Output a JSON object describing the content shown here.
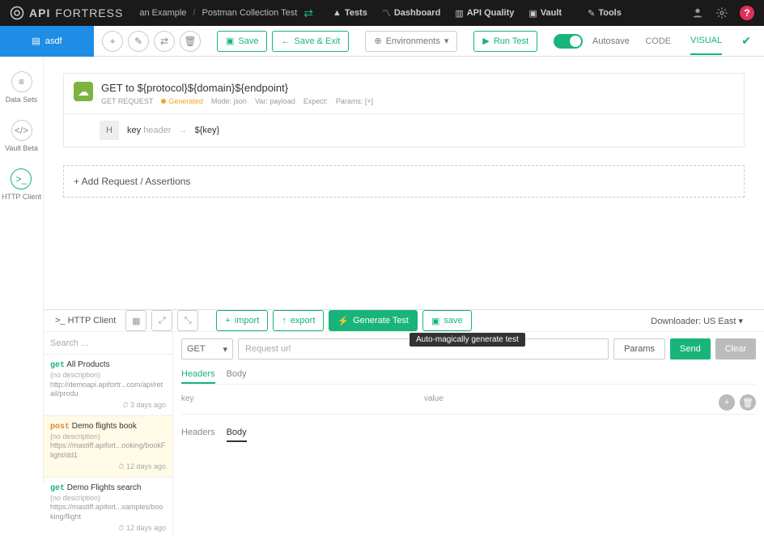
{
  "brand": {
    "bold": "API",
    "thin": "FORTRESS"
  },
  "breadcrumb": {
    "a": "an Example",
    "b": "Postman Collection Test"
  },
  "topnav": {
    "tests": "Tests",
    "dashboard": "Dashboard",
    "quality": "API Quality",
    "vault": "Vault",
    "tools": "Tools"
  },
  "file_tab": "asdf",
  "toolbar": {
    "save": "Save",
    "save_exit": "Save & Exit",
    "environments": "Environments",
    "run_test": "Run Test",
    "autosave": "Autosave",
    "code": "CODE",
    "visual": "VISUAL"
  },
  "rail": {
    "datasets": "Data Sets",
    "vault": "Vault Beta",
    "http": "HTTP Client"
  },
  "request": {
    "title": "GET to ${protocol}${domain}${endpoint}",
    "sub": "GET REQUEST",
    "gen": "Generated",
    "mode_l": "Mode:",
    "mode_v": "json",
    "var_l": "Var:",
    "var_v": "payload",
    "expect_l": "Expect:",
    "params_l": "Params:",
    "params_v": "[+]",
    "hk": "key",
    "hk2": "header",
    "hv": "${key}"
  },
  "add_req": "+ Add Request / Assertions",
  "bottom_bar": {
    "title": "HTTP Client",
    "import": "import",
    "export": "export",
    "generate": "Generate Test",
    "save": "save",
    "downloader": "Downloader: US East",
    "tooltip": "Auto-magically generate test"
  },
  "search_placeholder": "Search ...",
  "history": [
    {
      "verb": "get",
      "name": "All Products",
      "desc": "(no description)",
      "url": "http://demoapi.apifortr...com/api/retail/produ",
      "time": "3 days ago"
    },
    {
      "verb": "post",
      "name": "Demo flights book",
      "desc": "(no description)",
      "url": "https://mastiff.apifort...ooking/bookFlight/dd1",
      "time": "12 days ago"
    },
    {
      "verb": "get",
      "name": "Demo Flights search",
      "desc": "(no description)",
      "url": "https://mastiff.apifort...xamples/booking/flight",
      "time": "12 days ago"
    }
  ],
  "builder": {
    "method": "GET",
    "url_ph": "Request url",
    "params": "Params",
    "send": "Send",
    "clear": "Clear",
    "tab_headers": "Headers",
    "tab_body": "Body",
    "key": "key",
    "value": "value",
    "resp_headers": "Headers",
    "resp_body": "Body"
  }
}
